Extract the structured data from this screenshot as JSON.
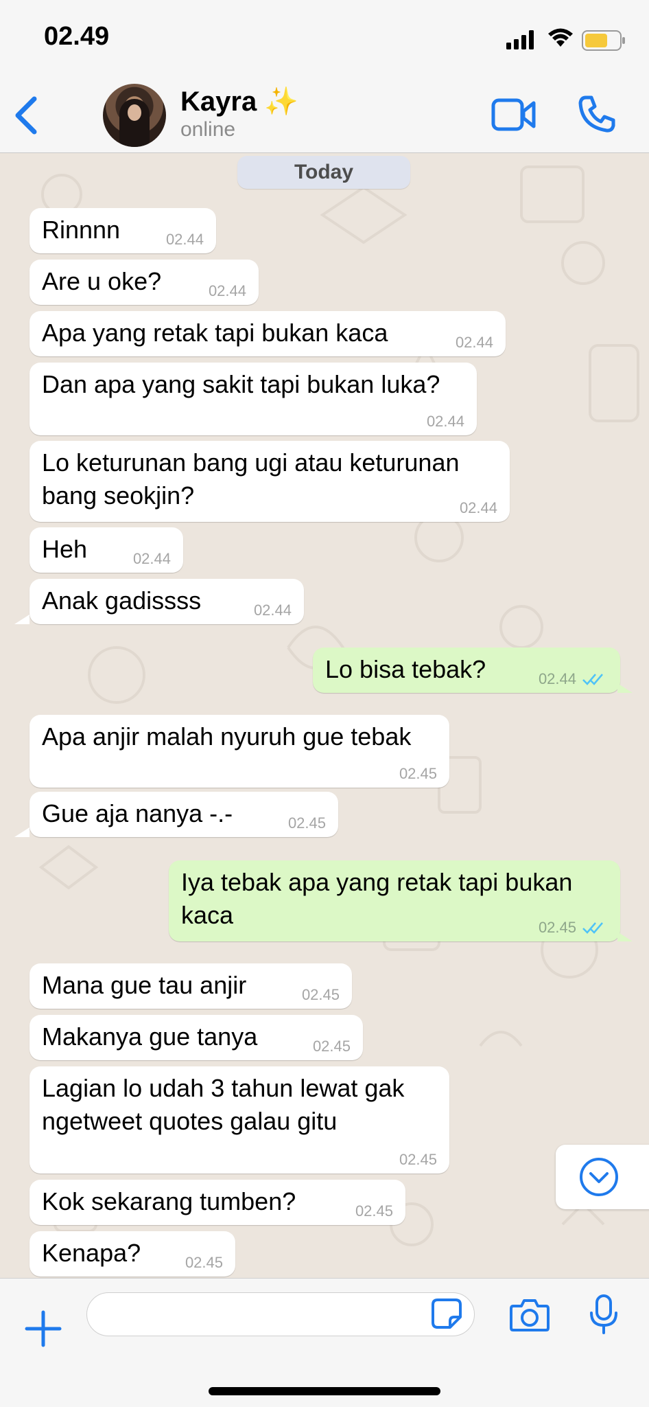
{
  "status_bar": {
    "time": "02.49"
  },
  "header": {
    "contact_name": "Kayra ✨",
    "contact_status": "online"
  },
  "chat": {
    "date_label": "Today",
    "messages": [
      {
        "dir": "in",
        "text": "Rinnnn",
        "time": "02.44"
      },
      {
        "dir": "in",
        "text": "Are u oke?",
        "time": "02.44"
      },
      {
        "dir": "in",
        "text": "Apa yang retak tapi bukan kaca",
        "time": "02.44"
      },
      {
        "dir": "in",
        "text": "Dan apa yang sakit tapi bukan luka?",
        "time": "02.44"
      },
      {
        "dir": "in",
        "text": "Lo keturunan bang ugi atau keturunan bang seokjin?",
        "time": "02.44"
      },
      {
        "dir": "in",
        "text": "Heh",
        "time": "02.44"
      },
      {
        "dir": "in",
        "text": "Anak gadissss",
        "time": "02.44"
      },
      {
        "dir": "out",
        "text": "Lo bisa tebak?",
        "time": "02.44"
      },
      {
        "dir": "in",
        "text": "Apa anjir malah nyuruh gue tebak",
        "time": "02.45"
      },
      {
        "dir": "in",
        "text": "Gue aja nanya -.-",
        "time": "02.45"
      },
      {
        "dir": "out",
        "text": "Iya tebak apa yang retak tapi bukan kaca",
        "time": "02.45"
      },
      {
        "dir": "in",
        "text": "Mana gue tau anjir",
        "time": "02.45"
      },
      {
        "dir": "in",
        "text": "Makanya gue tanya",
        "time": "02.45"
      },
      {
        "dir": "in",
        "text": "Lagian lo udah 3 tahun lewat gak ngetweet quotes galau gitu",
        "time": "02.45"
      },
      {
        "dir": "in",
        "text": "Kok sekarang tumben?",
        "time": "02.45"
      },
      {
        "dir": "in",
        "text": "Kenapa?",
        "time": "02.45"
      }
    ]
  },
  "input_bar": {
    "message_value": "",
    "message_placeholder": ""
  },
  "colors": {
    "accent": "#1f7aec",
    "outgoing_bubble": "#dcf8c6",
    "incoming_bubble": "#ffffff",
    "chat_background": "#ece5dd",
    "read_ticks": "#4fc3f7"
  },
  "icons": {
    "back": "chevron-left-icon",
    "video": "video-camera-icon",
    "call": "phone-icon",
    "scroll": "chevron-down-circle-icon",
    "plus": "plus-icon",
    "sticker": "sticker-icon",
    "camera": "camera-icon",
    "mic": "microphone-icon"
  }
}
